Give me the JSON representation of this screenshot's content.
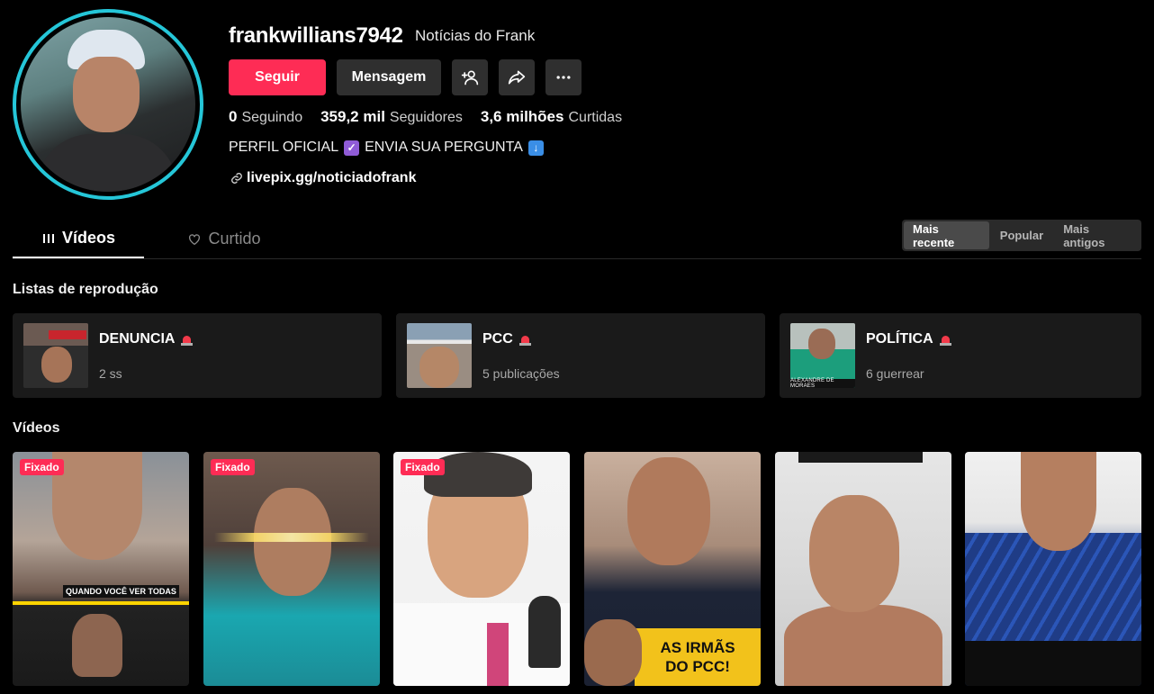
{
  "profile": {
    "username": "frankwillians7942",
    "nickname": "Notícias do Frank",
    "follow_label": "Seguir",
    "message_label": "Mensagem",
    "stats": {
      "following_value": "0",
      "following_label": "Seguindo",
      "followers_value": "359,2 mil",
      "followers_label": "Seguidores",
      "likes_value": "3,6 milhões",
      "likes_label": "Curtidas"
    },
    "bio_part1": "PERFIL OFICIAL",
    "bio_part2": "ENVIA SUA PERGUNTA",
    "link": "livepix.gg/noticiadofrank",
    "accent_color": "#fe2c55",
    "ring_color": "#25c6d8"
  },
  "tabs": {
    "videos": "Vídeos",
    "liked": "Curtido"
  },
  "sort": {
    "recent": "Mais recente",
    "popular": "Popular",
    "oldest": "Mais antigos"
  },
  "playlists": {
    "title": "Listas de reprodução",
    "items": [
      {
        "name": "DENUNCIA",
        "sub": "2 ss",
        "thumb_text": "MULHER DO MANO"
      },
      {
        "name": "PCC",
        "sub": "5 publicações"
      },
      {
        "name": "POLÍTICA",
        "sub": "6 guerrear",
        "thumb_text": "ALEXANDRE DE MORAES"
      }
    ]
  },
  "videos": {
    "title": "Vídeos",
    "pinned_label": "Fixado",
    "v1_caption": "QUANDO VOCÊ VER TODAS",
    "v4_banner_line1": "AS IRMÃS",
    "v4_banner_line2": "DO PCC!"
  }
}
